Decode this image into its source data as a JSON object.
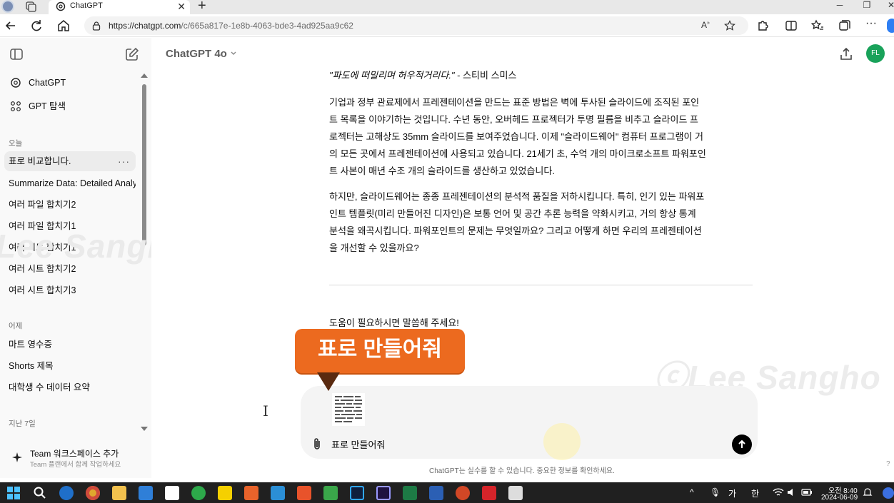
{
  "browser": {
    "tab_title": "ChatGPT",
    "url_host": "https://chatgpt.com",
    "url_path": "/c/665a817e-1e8b-4063-bde3-4ad925aa9c62"
  },
  "sidebar": {
    "top_items": [
      {
        "label": "ChatGPT",
        "icon": "openai-logo-icon"
      },
      {
        "label": "GPT 탐색",
        "icon": "grid-icon"
      }
    ],
    "sections": [
      {
        "heading": "오늘",
        "items": [
          "표로 비교합니다.",
          "Summarize Data: Detailed Analy",
          "여러 파일 합치기2",
          "여러 파일 합치기1",
          "여러 시트 합치기1",
          "여러 시트 합치기2",
          "여러 시트 합치기3"
        ]
      },
      {
        "heading": "어제",
        "items": [
          "마트 영수증",
          "Shorts 제목",
          "대학생 수 데이터 요약"
        ]
      },
      {
        "heading": "지난 7일",
        "items": []
      }
    ],
    "more_label": "···",
    "team_title": "Team 워크스페이스 추가",
    "team_subtitle": "Team 플랜에서 함께 작업하세요"
  },
  "header": {
    "model": "ChatGPT 4o",
    "avatar_initials": "FL"
  },
  "conversation": {
    "quote_text": "\"파도에 떠밀리며 허우적거리다.\"",
    "quote_author": " - 스티비 스미스",
    "paragraph1_lines": [
      "기업과 정부 관료제에서 프레젠테이션을 만드는 표준 방법은 벽에 투사된 슬라이드에 조직된 포인",
      "트 목록을 이야기하는 것입니다. 수년 동안, 오버헤드 프로젝터가 투명 필름을 비추고 슬라이드 프",
      "로젝터는 고해상도 35mm 슬라이드를 보여주었습니다. 이제 \"슬라이드웨어\" 컴퓨터 프로그램이 거",
      "의 모든 곳에서 프레젠테이션에 사용되고 있습니다. 21세기 초, 수억 개의 마이크로소프트 파워포인",
      "트 사본이 매년 수조 개의 슬라이드를 생산하고 있었습니다."
    ],
    "paragraph2_lines": [
      "하지만, 슬라이드웨어는 종종 프레젠테이션의 분석적 품질을 저하시킵니다. 특히, 인기 있는 파워포",
      "인트 템플릿(미리 만들어진 디자인)은 보통 언어 및 공간 추론 능력을 약화시키고, 거의 항상 통계",
      "분석을 왜곡시킵니다. 파워포인트의 문제는 무엇일까요? 그리고 어떻게 하면 우리의 프레젠테이션",
      "을 개선할 수 있을까요?"
    ],
    "help_text": "도움이 필요하시면 말씀해 주세요!"
  },
  "overlay": {
    "callout_text": "표로 만들어줘",
    "watermark_left": "Lee Sanghoon",
    "watermark_right": "ⓒLee Sangho"
  },
  "composer": {
    "input_value": "표로 만들어줘",
    "disclaimer": "ChatGPT는 실수를 할 수 있습니다. 중요한 정보를 확인하세요.",
    "help_mark": "?"
  },
  "taskbar": {
    "ime_mode": "가",
    "ime_lang": "한",
    "time": "오전 8:40",
    "date": "2024-06-09"
  },
  "colors": {
    "callout": "#ec6a1f",
    "avatar": "#19a25a",
    "sidebar_bg": "#f9f9f9",
    "composer_bg": "#f4f4f4"
  }
}
